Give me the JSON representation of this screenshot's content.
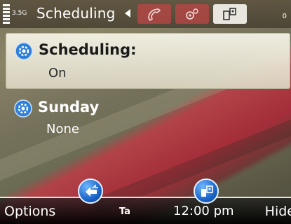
{
  "status_bar": {
    "network": "3.5G",
    "title": "Scheduling",
    "battery": "0"
  },
  "tabs": [
    {
      "name": "phone-tab",
      "icon": "phone-icon"
    },
    {
      "name": "settings-tab",
      "icon": "gear-sync-icon"
    },
    {
      "name": "device-tab",
      "icon": "device-sync-icon"
    }
  ],
  "list": [
    {
      "title": "Scheduling:",
      "value": "On",
      "icon": "settings-gear-icon"
    },
    {
      "title": "Sunday",
      "value": "None",
      "icon": "settings-gear-icon"
    }
  ],
  "toolbar": {
    "options_label": "Options",
    "input_mode": "Ta",
    "time": "12:00 pm",
    "hide_label": "Hide"
  },
  "colors": {
    "accent_blue": "#1b66c9",
    "tab_red": "#be4646",
    "selection": "#f3f1e4"
  }
}
